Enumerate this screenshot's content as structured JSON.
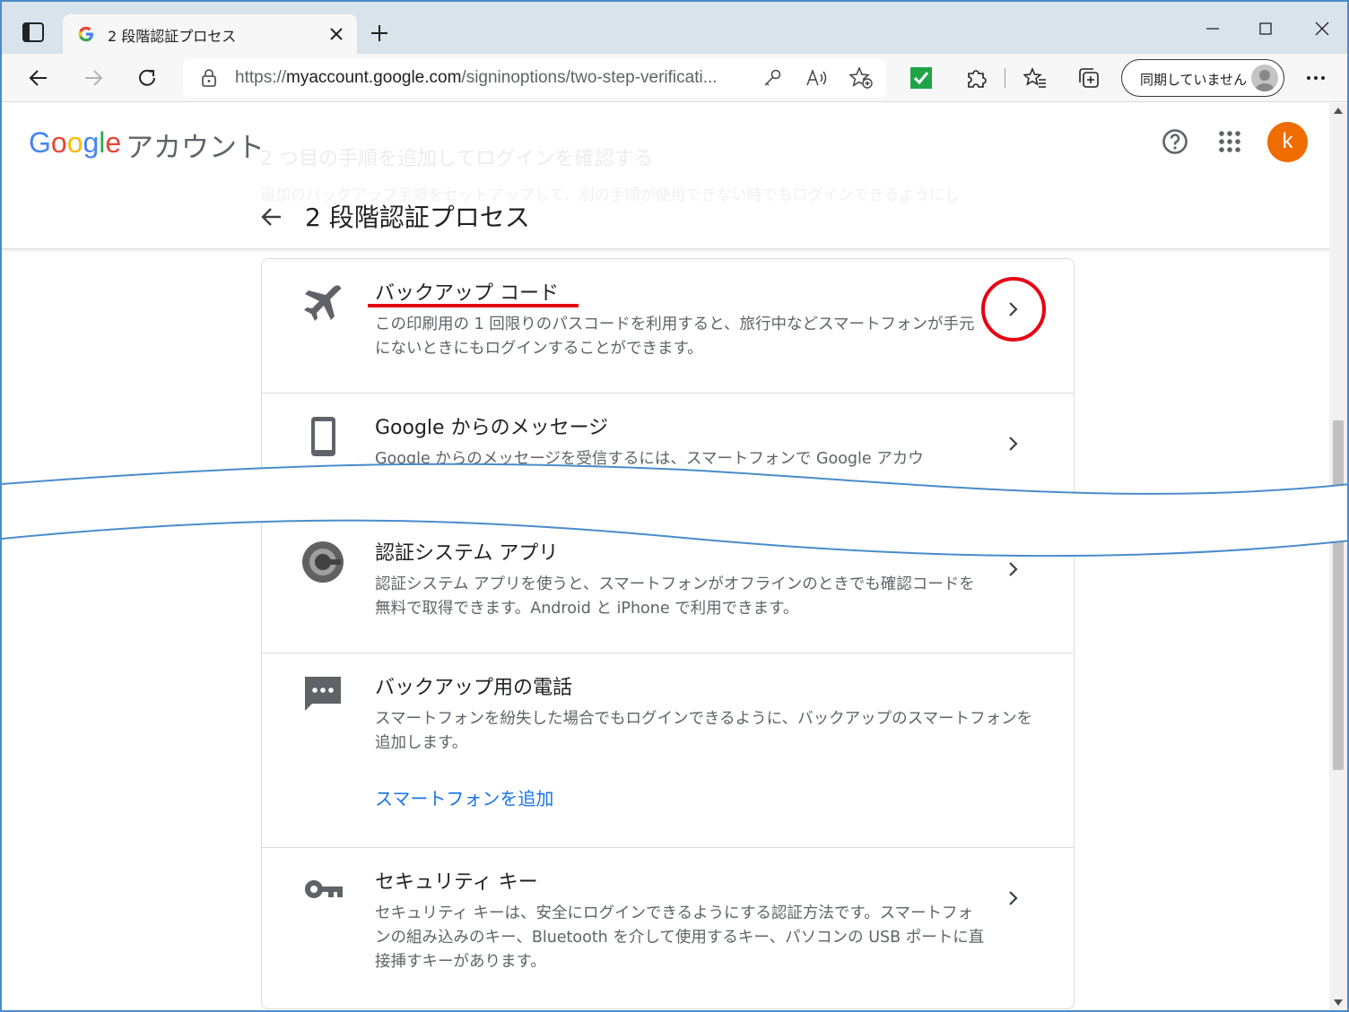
{
  "browser": {
    "tab_title": "2 段階認証プロセス",
    "url_prefix": "https://",
    "url_domain": "myaccount.google.com",
    "url_path": "/signinoptions/two-step-verificati...",
    "sync_label": "同期していません"
  },
  "header": {
    "logo": [
      "G",
      "o",
      "o",
      "g",
      "l",
      "e"
    ],
    "account_label": "アカウント",
    "avatar_letter": "k",
    "page_title": "2 段階認証プロセス",
    "ghost_title": "2 つ目の手順を追加してログインを確認する",
    "ghost_desc": "追加のバックアップ手順をセットアップして、別の手順が使用できない時でもログインできるようにし"
  },
  "options": [
    {
      "title": "バックアップ コード",
      "desc": "この印刷用の 1 回限りのパスコードを利用すると、旅行中などスマートフォンが手元にないときにもログインすることができます。",
      "icon": "airplane-icon"
    },
    {
      "title": "Google からのメッセージ",
      "desc": "Google からのメッセージを受信するには、スマートフォンで Google アカウ",
      "icon": "smartphone-icon"
    },
    {
      "title": "認証システム アプリ",
      "desc": "認証システム アプリを使うと、スマートフォンがオフラインのときでも確認コードを無料で取得できます。Android と iPhone で利用できます。",
      "icon": "authenticator-icon"
    },
    {
      "title": "バックアップ用の電話",
      "desc": "スマートフォンを紛失した場合でもログインできるように、バックアップのスマートフォンを追加します。",
      "link": "スマートフォンを追加",
      "icon": "message-icon"
    },
    {
      "title": "セキュリティ キー",
      "desc": "セキュリティ キーは、安全にログインできるようにする認証方法です。スマートフォンの組み込みのキー、Bluetooth を介して使用するキー、パソコンの USB ポートに直接挿すキーがあります。",
      "icon": "key-icon"
    }
  ],
  "colors": {
    "annotation": "#e60012",
    "wave": "#4a8ccb",
    "avatar": "#ef6c00",
    "link": "#1a73e8"
  }
}
